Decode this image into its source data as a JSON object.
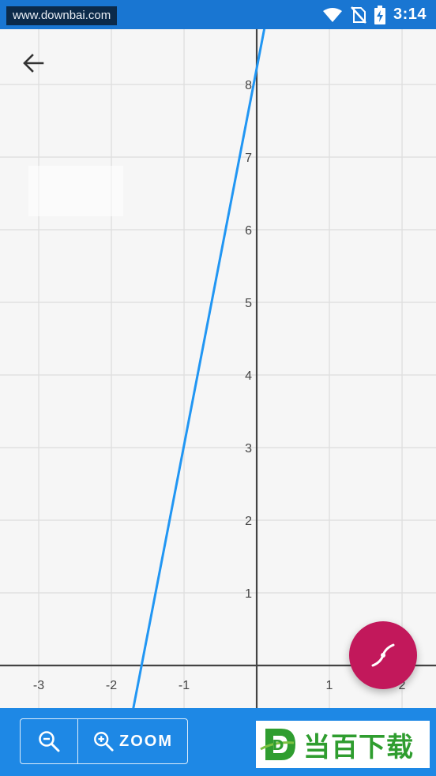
{
  "status_bar": {
    "watermark_url": "www.downbai.com",
    "time": "3:14",
    "icons": [
      "wifi-icon",
      "no-sim-icon",
      "battery-charging-icon"
    ]
  },
  "toolbar": {
    "back_icon": "arrow-back-icon"
  },
  "graph": {
    "x_ticks": [
      "-3",
      "-2",
      "-1",
      "1",
      "2"
    ],
    "y_ticks": [
      "1",
      "2",
      "3",
      "4",
      "5",
      "6",
      "7",
      "8"
    ],
    "line_color": "#2196f3",
    "grid_color": "#dddddd",
    "axis_color": "#444444",
    "line_points": [
      [
        -1.7,
        -0.6
      ],
      [
        0.15,
        9.0
      ]
    ]
  },
  "fab": {
    "icon": "curve-plot-icon",
    "color": "#c2185b"
  },
  "bottom_bar": {
    "zoom_out_icon": "zoom-out-icon",
    "zoom_in_icon": "zoom-in-icon",
    "zoom_label": "ZOOM",
    "brand_text": "当百下载",
    "brand_letter": "D"
  }
}
